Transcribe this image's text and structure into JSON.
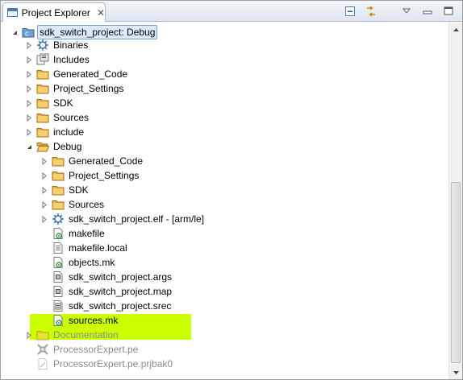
{
  "titlebar": {
    "tab_label": "Project Explorer",
    "close_glyph": "✕",
    "icons": [
      "view-icon",
      "collapse-all-icon",
      "link-editor-icon",
      "view-menu-icon",
      "minimize-icon",
      "maximize-icon"
    ]
  },
  "colors": {
    "highlight": "#ccff00",
    "selection_bg": "#dcebfc",
    "folder": "#e8b24a",
    "dim_text": "#8a8a8a"
  },
  "tree": {
    "items": [
      {
        "label": "sdk_switch_project: Debug",
        "icon": "project-icon",
        "twisty": "expanded",
        "selected": true
      },
      {
        "label": "Binaries",
        "icon": "binaries-icon",
        "twisty": "collapsed"
      },
      {
        "label": "Includes",
        "icon": "includes-icon",
        "twisty": "collapsed"
      },
      {
        "label": "Generated_Code",
        "icon": "folder-icon",
        "twisty": "collapsed"
      },
      {
        "label": "Project_Settings",
        "icon": "folder-icon",
        "twisty": "collapsed"
      },
      {
        "label": "SDK",
        "icon": "folder-icon",
        "twisty": "collapsed"
      },
      {
        "label": "Sources",
        "icon": "folder-icon",
        "twisty": "collapsed"
      },
      {
        "label": "include",
        "icon": "folder-icon",
        "twisty": "collapsed"
      },
      {
        "label": "Debug",
        "icon": "folder-open-icon",
        "twisty": "expanded"
      },
      {
        "label": "Generated_Code",
        "icon": "folder-icon",
        "twisty": "collapsed"
      },
      {
        "label": "Project_Settings",
        "icon": "folder-icon",
        "twisty": "collapsed"
      },
      {
        "label": "SDK",
        "icon": "folder-icon",
        "twisty": "collapsed"
      },
      {
        "label": "Sources",
        "icon": "folder-icon",
        "twisty": "collapsed"
      },
      {
        "label": "sdk_switch_project.elf - [arm/le]",
        "icon": "binary-elf-icon",
        "twisty": "collapsed"
      },
      {
        "label": "makefile",
        "icon": "make-file-icon",
        "twisty": "none"
      },
      {
        "label": "makefile.local",
        "icon": "text-file-icon",
        "twisty": "none"
      },
      {
        "label": "objects.mk",
        "icon": "make-file-icon",
        "twisty": "none"
      },
      {
        "label": "sdk_switch_project.args",
        "icon": "generic-file-icon",
        "twisty": "none"
      },
      {
        "label": "sdk_switch_project.map",
        "icon": "generic-file-icon",
        "twisty": "none"
      },
      {
        "label": "sdk_switch_project.srec",
        "icon": "srec-file-icon",
        "twisty": "none"
      },
      {
        "label": "sources.mk",
        "icon": "make-file-icon",
        "twisty": "none"
      },
      {
        "label": "Documentation",
        "icon": "folder-icon",
        "twisty": "collapsed",
        "dim": true
      },
      {
        "label": "ProcessorExpert.pe",
        "icon": "processor-expert-icon",
        "twisty": "none",
        "dim": true
      },
      {
        "label": "ProcessorExpert.pe.prjbak0",
        "icon": "processor-expert-bak-icon",
        "twisty": "none",
        "dim": true
      }
    ]
  }
}
